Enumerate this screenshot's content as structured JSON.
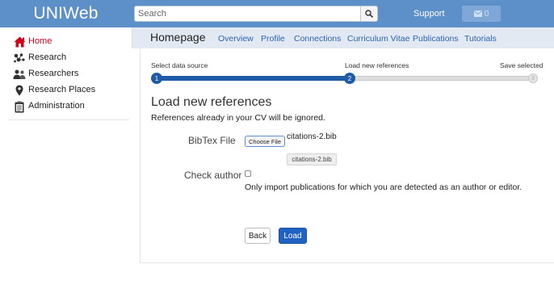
{
  "app": {
    "logo_text": "UNIWeb",
    "colors": {
      "topbar": "#5d8fc9",
      "accent": "#1f5aa6",
      "active_nav": "#d0021b",
      "link": "#2b64b8"
    }
  },
  "topbar": {
    "search_placeholder": "Search",
    "search_icon": "search-icon",
    "support_label": "Support",
    "messages_icon": "envelope-icon",
    "messages_count": "0"
  },
  "sidebar": {
    "items": [
      {
        "label": "Home",
        "icon": "home-icon",
        "active": true
      },
      {
        "label": "Research",
        "icon": "research-icon",
        "active": false
      },
      {
        "label": "Researchers",
        "icon": "people-icon",
        "active": false
      },
      {
        "label": "Research Places",
        "icon": "map-marker-icon",
        "active": false
      },
      {
        "label": "Administration",
        "icon": "clipboard-icon",
        "active": false
      }
    ]
  },
  "header": {
    "title": "Homepage",
    "tabs": [
      {
        "label": "Overview"
      },
      {
        "label": "Profile"
      },
      {
        "label": "Connections"
      },
      {
        "label": "Curriculum Vitae"
      },
      {
        "label": "Publications"
      },
      {
        "label": "Tutorials"
      }
    ]
  },
  "wizard": {
    "steps": [
      {
        "label": "Select data source",
        "number": "1",
        "state": "done"
      },
      {
        "label": "Load new references",
        "number": "2",
        "state": "current"
      },
      {
        "label": "Save selected",
        "number": "3",
        "state": "pending"
      }
    ]
  },
  "form": {
    "title": "Load new references",
    "subtitle": "References already in your CV will be ignored.",
    "bibtex_label": "BibTex File",
    "choose_file_label": "Choose File",
    "file_name": "citations-2.bib",
    "file_chip": "citations-2.bib",
    "check_author_label": "Check author",
    "check_author_checked": false,
    "check_author_desc": "Only import publications for which you are detected as an author or editor.",
    "back_label": "Back",
    "load_label": "Load"
  }
}
